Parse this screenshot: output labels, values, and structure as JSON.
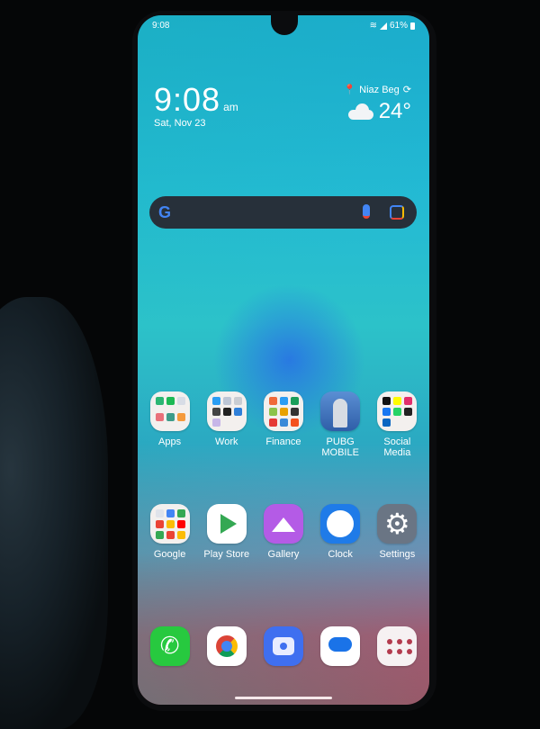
{
  "status_bar": {
    "time": "9:08",
    "battery": "61%"
  },
  "clock_widget": {
    "time": "9:08",
    "ampm": "am",
    "date": "Sat, Nov 23"
  },
  "weather_widget": {
    "location": "Niaz Beg",
    "temperature": "24°",
    "condition_icon": "cloud-icon"
  },
  "search_bar": {
    "g_label": "G"
  },
  "home_row1": [
    {
      "label": "Apps"
    },
    {
      "label": "Work"
    },
    {
      "label": "Finance"
    },
    {
      "label": "PUBG\nMOBILE"
    },
    {
      "label": "Social\nMedia"
    }
  ],
  "home_row2": [
    {
      "label": "Google"
    },
    {
      "label": "Play Store"
    },
    {
      "label": "Gallery"
    },
    {
      "label": "Clock"
    },
    {
      "label": "Settings"
    }
  ],
  "dock": [
    {
      "name": "Phone"
    },
    {
      "name": "Chrome"
    },
    {
      "name": "Camera"
    },
    {
      "name": "Messages"
    },
    {
      "name": "App Drawer"
    }
  ]
}
